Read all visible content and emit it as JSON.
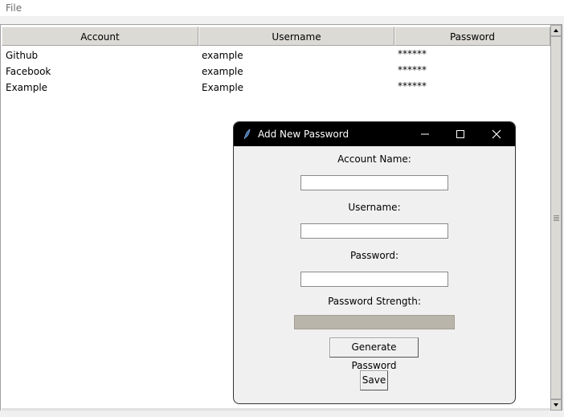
{
  "menubar": {
    "items": [
      {
        "label": "File"
      }
    ]
  },
  "tree": {
    "columns": [
      {
        "label": "Account"
      },
      {
        "label": "Username"
      },
      {
        "label": "Password"
      }
    ],
    "rows": [
      {
        "account": "Github",
        "username": "example",
        "password": "******"
      },
      {
        "account": "Facebook",
        "username": "example",
        "password": "******"
      },
      {
        "account": "Example",
        "username": "Example",
        "password": "******"
      }
    ]
  },
  "dialog": {
    "title": "Add New Password",
    "title_icon": "feather-icon",
    "account_label": "Account Name:",
    "account_value": "",
    "username_label": "Username:",
    "username_value": "",
    "password_label": "Password:",
    "password_value": "",
    "strength_label": "Password Strength:",
    "strength_value": 0,
    "generate_label": "Generate Password",
    "save_label": "Save"
  },
  "colors": {
    "titlebar": "#000000",
    "header_bg": "#dcdad5",
    "progress_trough": "#bab5ab"
  }
}
